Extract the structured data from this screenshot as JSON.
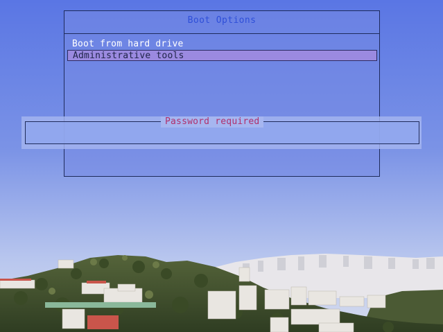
{
  "menu": {
    "title": "Boot Options",
    "items": [
      {
        "label": "Boot from hard drive",
        "selected": false
      },
      {
        "label": "Administrative tools",
        "selected": true
      }
    ]
  },
  "password": {
    "title": "Password required",
    "value": ""
  },
  "colors": {
    "sky_top": "#5b78e6",
    "sky_bottom": "#c7d1ee",
    "menu_title": "#2f4fd8",
    "selected_bg": "#9b8ae0",
    "password_title": "#b0306c"
  }
}
